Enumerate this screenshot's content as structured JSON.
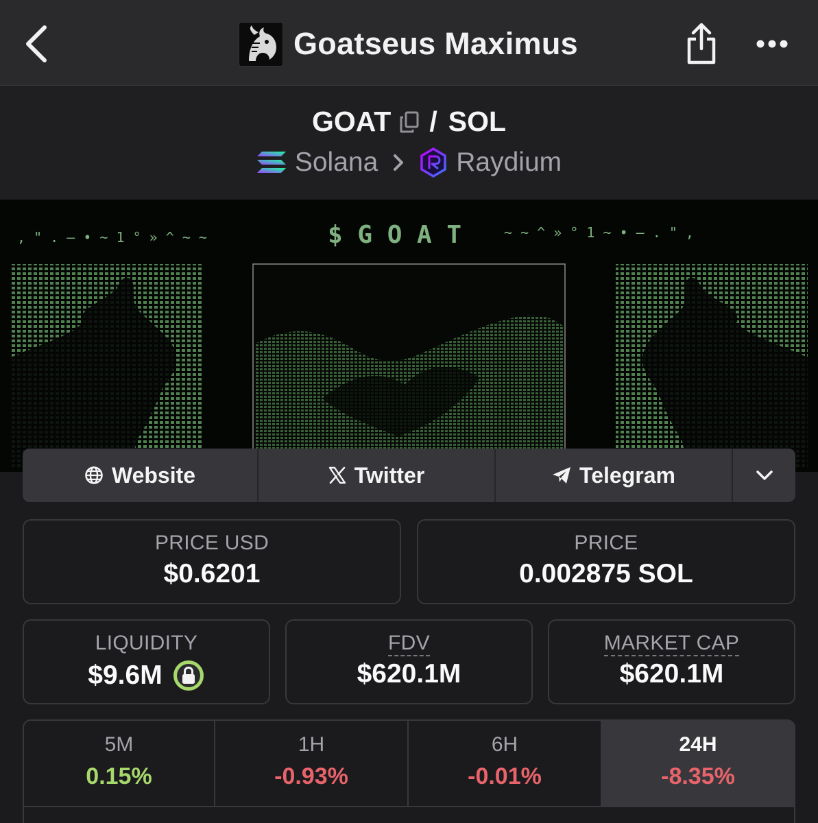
{
  "header": {
    "title": "Goatseus Maximus",
    "icons": {
      "back": "chevron-left-icon",
      "share": "share-icon",
      "more": "more-horizontal-icon"
    }
  },
  "pair": {
    "base": "GOAT",
    "separator": "/",
    "quote": "SOL",
    "chain": "Solana",
    "dex": "Raydium"
  },
  "banner": {
    "headline": "$ G O A T",
    "left_glyphs": ", \" . — • ~ 1 ° » ^ ~ ~",
    "right_glyphs": "~ ~ ^ » ° 1 ~ • — . \" ,"
  },
  "links": {
    "website": "Website",
    "twitter": "Twitter",
    "telegram": "Telegram"
  },
  "stats": {
    "price_usd": {
      "label": "PRICE USD",
      "value": "$0.6201"
    },
    "price": {
      "label": "PRICE",
      "value": "0.002875 SOL"
    },
    "liquidity": {
      "label": "LIQUIDITY",
      "value": "$9.6M"
    },
    "fdv": {
      "label": "FDV",
      "value": "$620.1M"
    },
    "market_cap": {
      "label": "MARKET CAP",
      "value": "$620.1M"
    }
  },
  "timeframes": [
    {
      "label": "5M",
      "value": "0.15%",
      "color": "#a6d86b"
    },
    {
      "label": "1H",
      "value": "-0.93%",
      "color": "#e8636a"
    },
    {
      "label": "6H",
      "value": "-0.01%",
      "color": "#e8636a"
    },
    {
      "label": "24H",
      "value": "-8.35%",
      "color": "#e8636a",
      "selected": true
    }
  ],
  "colors": {
    "background": "#1b1b1e",
    "topbar": "#2a2a2d",
    "positive": "#a6d86b",
    "negative": "#e8636a",
    "lock_badge": "#a6d86b",
    "banner_green": "#6ea86e"
  }
}
